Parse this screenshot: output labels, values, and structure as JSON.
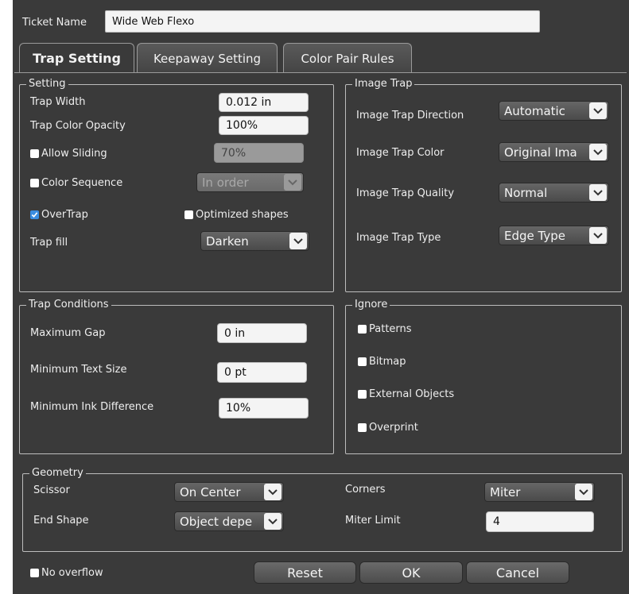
{
  "ticket": {
    "label": "Ticket Name",
    "value": "Wide Web Flexo"
  },
  "tabs": [
    {
      "label": "Trap Setting"
    },
    {
      "label": "Keepaway Setting"
    },
    {
      "label": "Color Pair Rules"
    }
  ],
  "setting": {
    "legend": "Setting",
    "trap_width_label": "Trap Width",
    "trap_width_value": "0.012 in",
    "trap_color_opacity_label": "Trap Color Opacity",
    "trap_color_opacity_value": "100%",
    "allow_sliding_label": "Allow Sliding",
    "allow_sliding_value": "70%",
    "color_sequence_label": "Color Sequence",
    "color_sequence_value": "In order",
    "overtrap_label": "OverTrap",
    "optimized_shapes_label": "Optimized shapes",
    "trap_fill_label": "Trap fill",
    "trap_fill_value": "Darken"
  },
  "image_trap": {
    "legend": "Image Trap",
    "direction_label": "Image Trap Direction",
    "direction_value": "Automatic",
    "color_label": "Image Trap Color",
    "color_value": "Original Ima",
    "quality_label": "Image Trap Quality",
    "quality_value": "Normal",
    "type_label": "Image Trap Type",
    "type_value": "Edge Type"
  },
  "trap_conditions": {
    "legend": "Trap Conditions",
    "max_gap_label": "Maximum Gap",
    "max_gap_value": "0 in",
    "min_text_label": "Minimum Text Size",
    "min_text_value": "0 pt",
    "min_ink_label": "Minimum Ink Difference",
    "min_ink_value": "10%"
  },
  "ignore": {
    "legend": "Ignore",
    "patterns_label": "Patterns",
    "bitmap_label": "Bitmap",
    "external_label": "External Objects",
    "overprint_label": "Overprint"
  },
  "geometry": {
    "legend": "Geometry",
    "scissor_label": "Scissor",
    "scissor_value": "On Center",
    "corners_label": "Corners",
    "corners_value": "Miter",
    "end_shape_label": "End Shape",
    "end_shape_value": "Object depe",
    "miter_limit_label": "Miter Limit",
    "miter_limit_value": "4"
  },
  "footer": {
    "no_overflow_label": "No overflow",
    "reset_label": "Reset",
    "ok_label": "OK",
    "cancel_label": "Cancel"
  },
  "colors": {
    "accent": "#3a8de0",
    "panel": "#3a3a3a"
  }
}
